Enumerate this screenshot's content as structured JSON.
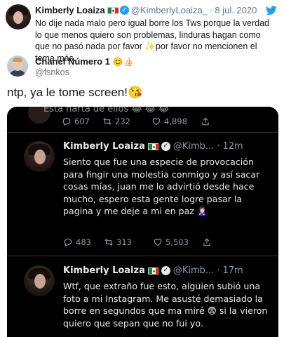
{
  "quoted": {
    "name": "Kimberly Loaiza",
    "handle": "@KimberlyLoaiza_",
    "dot": "·",
    "date": "8 jul. 2020",
    "text_1": "No dije nada malo pero igual borre los Tws porque la verdad lo que menos quiero son problemas, linduras hagan como que no pasó nada por favor ",
    "sparkle": "✨",
    "text_2": "por favor no mencionen el tema más."
  },
  "author": {
    "name": "Chanel Número 1",
    "emoji": "😊👍🏻",
    "handle": "@fsnkos"
  },
  "main_text": "ntp, ya le tome screen!😘",
  "screenshot": {
    "cut_text": "Esta harta de ellos 😂 😂 😂",
    "top_actions": {
      "replies": "607",
      "retweets": "232",
      "likes": "4,898"
    },
    "tweets": [
      {
        "name": "Kimberly Loaiza",
        "handle": "@Kimb...",
        "dot": "·",
        "time": "12m",
        "body": "Siento que fue una especie de provocación para fingir una molestia conmigo y así sacar cosas mías, juan me lo advirtió desde hace mucho, espero esta gente logre pasar la pagina y me deje a mi en paz 🙎🏻‍♀️",
        "replies": "483",
        "retweets": "313",
        "likes": "5,503"
      },
      {
        "name": "Kimberly Loaiza",
        "handle": "@Kimb...",
        "dot": "·",
        "time": "17m",
        "body": "Wtf, que extraño fue esto, alguien subió una foto a mi Instagram. Me asusté demasiado la borre en segundos que ma miré 😨 si la vieron quiero que sepan que no fui yo."
      }
    ]
  }
}
